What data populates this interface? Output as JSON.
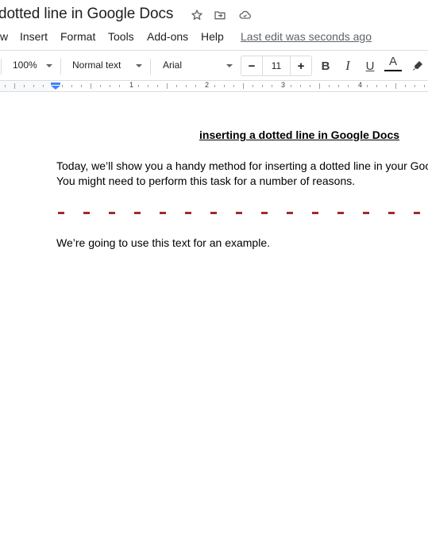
{
  "title_bar": {
    "doc_title": "dotted line in Google Docs",
    "icons": [
      "star-icon",
      "move-to-folder-icon",
      "cloud-saved-icon"
    ]
  },
  "menu": {
    "items": [
      "w",
      "Insert",
      "Format",
      "Tools",
      "Add-ons",
      "Help"
    ],
    "last_edit": "Last edit was seconds ago"
  },
  "toolbar": {
    "zoom": "100%",
    "style": "Normal text",
    "font": "Arial",
    "font_size": "11",
    "minus": "−",
    "plus": "+",
    "bold": "B",
    "italic": "I",
    "underline": "U",
    "text_color": "A",
    "text_color_value": "#000000"
  },
  "ruler": {
    "numbers": [
      "1",
      "2",
      "3",
      "4"
    ]
  },
  "document": {
    "heading": "inserting a dotted line in Google Docs",
    "paragraph_line1": "Today, we’ll show you a handy method for inserting a dotted line in your Google",
    "paragraph_line2": "You might need to perform this task for a number of reasons.",
    "dotted_line_color": "#9b2d2b",
    "dash_count": 15,
    "example_text": "We’re going to use this text for an example."
  }
}
